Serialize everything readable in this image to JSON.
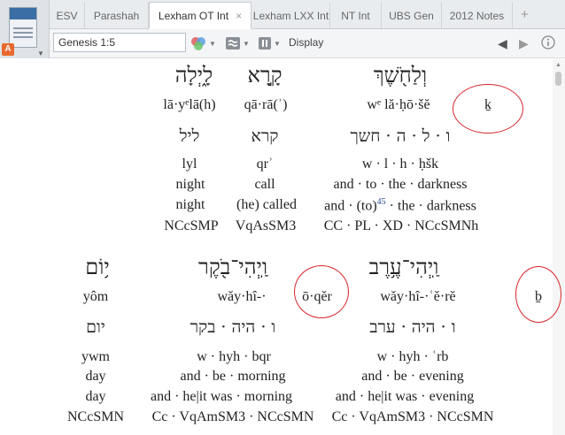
{
  "tabs": [
    {
      "label": "ESV"
    },
    {
      "label": "Parashah"
    },
    {
      "label": "Lexham OT Int"
    },
    {
      "label": "Lexham LXX Int"
    },
    {
      "label": "NT Int"
    },
    {
      "label": "UBS Gen"
    },
    {
      "label": "2012 Notes"
    }
  ],
  "toolbar": {
    "reference": "Genesis 1:5",
    "display_label": "Display"
  },
  "interlinear": {
    "row1": {
      "words": [
        {
          "hebrew": "לָ֑יְלָה",
          "translit": "lā·yᵉlā(h)",
          "lemma": "ליל",
          "lemma_translit": "lyl",
          "gloss": "night",
          "sense": "night",
          "morph": "NCcSMP"
        },
        {
          "hebrew": "קָ֣רָא",
          "translit": "qā·rā(ʾ)",
          "lemma": "קרא",
          "lemma_translit": "qrʾ",
          "gloss": "call",
          "sense_a": "(he)",
          "sense_b": "called",
          "morph": "VqAsSM3"
        },
        {
          "hebrew": "וְלַחֹ֖שֶׁךְ",
          "translit": "wᵉ lă·ḥō·šĕ",
          "lemma": "ו · ל · ה · חשך",
          "lemma_translit": "w · l · h · ḥšk",
          "gloss": "and · to · the · darkness",
          "sense_a": "and ·",
          "sense_b": "(to)",
          "sense_note": "45",
          "sense_c": "· the · darkness",
          "morph": "CC · PL · XD · NCcSMNh"
        }
      ],
      "callout": "ḵ"
    },
    "row2": {
      "words": [
        {
          "hebrew": "י֥וֹם",
          "translit": "yôm",
          "lemma": "יום",
          "lemma_translit": "ywm",
          "gloss": "day",
          "sense": "day",
          "morph": "NCcSMN"
        },
        {
          "hebrew": "וַֽיְהִי־בֹ֖קֶר",
          "translit": "wăy·hî-·",
          "translit_circled": "ō·qĕr",
          "lemma": "ו · היה · בקר",
          "lemma_translit": "w · hyh · bqr",
          "gloss": "and · be · morning",
          "sense": "and · he|it was · morning",
          "morph": "Cc · VqAmSM3 · NCcSMN"
        },
        {
          "hebrew": "וַֽיְהִי־עֶ֥רֶב",
          "translit": "wăy·hî-·ʿĕ·rĕ",
          "lemma": "ו · היה · ערב",
          "lemma_translit": "w · hyh · ʿrb",
          "gloss": "and · be · evening",
          "sense": "and · he|it was · evening",
          "morph": "Cc · VqAmSM3 · NCcSMN"
        }
      ],
      "callout": "ḇ"
    }
  },
  "colors": {
    "annotation_circle": "#d9262c",
    "footnote_link": "#2a4d9b",
    "badge": "#e8692c"
  }
}
